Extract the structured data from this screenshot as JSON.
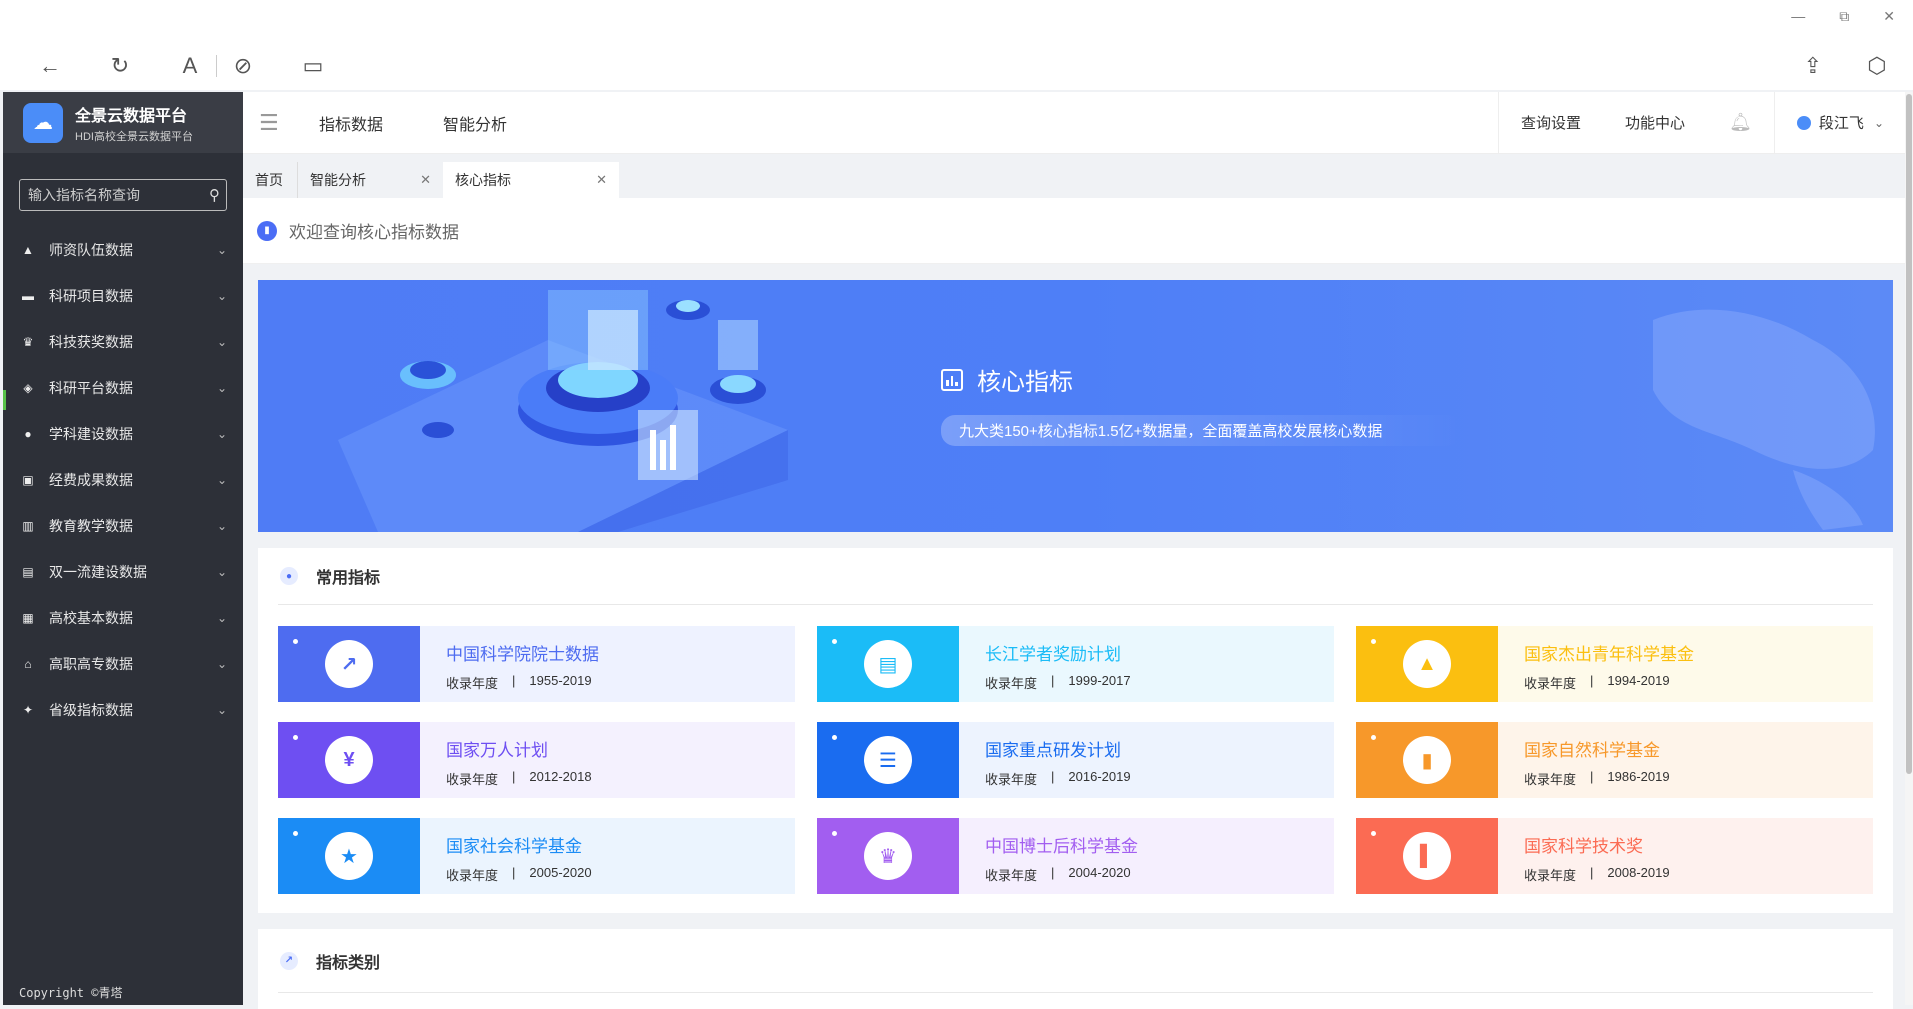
{
  "window": {
    "minimize": "—",
    "restore": "⧉",
    "close": "✕"
  },
  "chrome": {
    "back": "←",
    "reload": "↻",
    "reader": "A",
    "link": "⊘",
    "tabs_view": "▭",
    "share": "⇪",
    "extensions": "⬡"
  },
  "sidebar": {
    "logo_title": "全景云数据平台",
    "logo_subtitle": "HDI高校全景云数据平台",
    "search_placeholder": "输入指标名称查询",
    "items": [
      {
        "label": "师资队伍数据",
        "icon": "graduation-cap-icon"
      },
      {
        "label": "科研项目数据",
        "icon": "folder-icon"
      },
      {
        "label": "科技获奖数据",
        "icon": "trophy-icon"
      },
      {
        "label": "科研平台数据",
        "icon": "layers-icon"
      },
      {
        "label": "学科建设数据",
        "icon": "location-icon"
      },
      {
        "label": "经费成果数据",
        "icon": "wallet-icon"
      },
      {
        "label": "教育教学数据",
        "icon": "books-icon"
      },
      {
        "label": "双一流建设数据",
        "icon": "document-icon"
      },
      {
        "label": "高校基本数据",
        "icon": "list-icon"
      },
      {
        "label": "高职高专数据",
        "icon": "building-icon"
      },
      {
        "label": "省级指标数据",
        "icon": "map-icon"
      }
    ],
    "footer": "Copyright ©青塔"
  },
  "header": {
    "nav": [
      "指标数据",
      "智能分析"
    ],
    "query_settings": "查询设置",
    "function_center": "功能中心",
    "user_name": "段江飞"
  },
  "tabs": [
    {
      "label": "首页"
    },
    {
      "label": "智能分析",
      "close": "✕"
    },
    {
      "label": "核心指标",
      "close": "✕"
    }
  ],
  "welcome": "欢迎查询核心指标数据",
  "banner": {
    "title": "核心指标",
    "subtitle": "九大类150+核心指标1.5亿+数据量，全面覆盖高校发展核心数据"
  },
  "common": {
    "title": "常用指标",
    "year_label": "收录年度",
    "cards": [
      {
        "title": "中国科学院院士数据",
        "years": "1955-2019",
        "color": "#4e6cf0",
        "bg": "#eef2ff",
        "icon": "chart-up-icon",
        "glyph": "↗"
      },
      {
        "title": "长江学者奖励计划",
        "years": "1999-2017",
        "color": "#1bbcf7",
        "bg": "#eaf8fe",
        "icon": "presentation-icon",
        "glyph": "▤"
      },
      {
        "title": "国家杰出青年科学基金",
        "years": "1994-2019",
        "color": "#fbbf10",
        "bg": "#fefaea",
        "icon": "graduation-cap-icon",
        "glyph": "▲"
      },
      {
        "title": "国家万人计划",
        "years": "2012-2018",
        "color": "#6e4ff2",
        "bg": "#f4f1fe",
        "icon": "money-icon",
        "glyph": "¥"
      },
      {
        "title": "国家重点研发计划",
        "years": "2016-2019",
        "color": "#1a6cf0",
        "bg": "#edf3fe",
        "icon": "database-icon",
        "glyph": "☰"
      },
      {
        "title": "国家自然科学基金",
        "years": "1986-2019",
        "color": "#f7982a",
        "bg": "#fef4ea",
        "icon": "bar-chart-icon",
        "glyph": "▮"
      },
      {
        "title": "国家社会科学基金",
        "years": "2005-2020",
        "color": "#1b8cf5",
        "bg": "#ebf4fe",
        "icon": "medal-icon",
        "glyph": "★"
      },
      {
        "title": "中国博士后科学基金",
        "years": "2004-2020",
        "color": "#a25ef0",
        "bg": "#f5effe",
        "icon": "trophy-icon",
        "glyph": "♛"
      },
      {
        "title": "国家科学技术奖",
        "years": "2008-2019",
        "color": "#fb6b53",
        "bg": "#fef1ee",
        "icon": "book-icon",
        "glyph": "▌"
      }
    ]
  },
  "categories": {
    "title": "指标类别"
  }
}
